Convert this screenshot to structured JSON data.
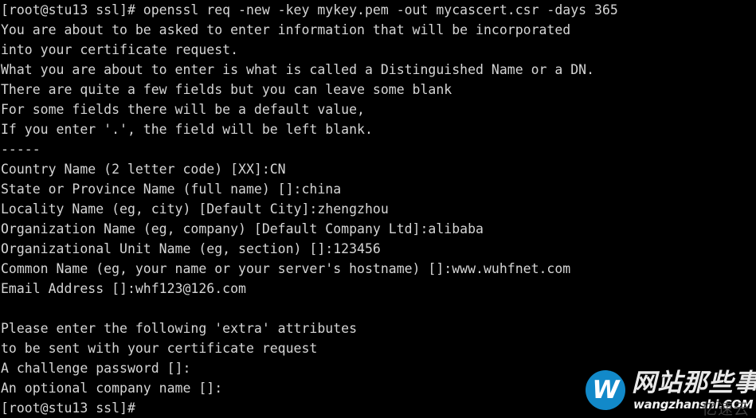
{
  "terminal": {
    "background_color": "#000000",
    "foreground_color": "#d5d5d5",
    "lines": [
      "[root@stu13 ssl]# openssl req -new -key mykey.pem -out mycascert.csr -days 365",
      "You are about to be asked to enter information that will be incorporated",
      "into your certificate request.",
      "What you are about to enter is what is called a Distinguished Name or a DN.",
      "There are quite a few fields but you can leave some blank",
      "For some fields there will be a default value,",
      "If you enter '.', the field will be left blank.",
      "-----",
      "Country Name (2 letter code) [XX]:CN",
      "State or Province Name (full name) []:china",
      "Locality Name (eg, city) [Default City]:zhengzhou",
      "Organization Name (eg, company) [Default Company Ltd]:alibaba",
      "Organizational Unit Name (eg, section) []:123456",
      "Common Name (eg, your name or your server's hostname) []:www.wuhfnet.com",
      "Email Address []:whf123@126.com",
      "",
      "Please enter the following 'extra' attributes",
      "to be sent with your certificate request",
      "A challenge password []:",
      "An optional company name []:",
      "[root@stu13 ssl]#"
    ],
    "prompt": "[root@stu13 ssl]#",
    "command": "openssl req -new -key mykey.pem -out mycascert.csr -days 365"
  },
  "watermark": {
    "logo_letter": "W",
    "logo_color": "#1289c9",
    "site_name_cn": "网站那些事",
    "site_url": "wangzhanshi.COM",
    "faint_overlay": "亿速云"
  }
}
